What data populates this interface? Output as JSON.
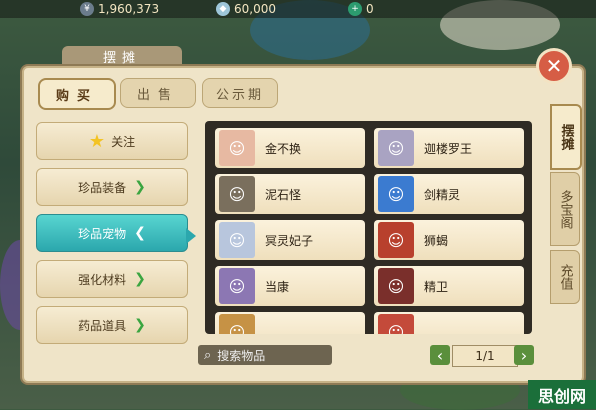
{
  "resources": {
    "coins": "1,960,373",
    "silver": "60,000",
    "jade": "0"
  },
  "panel": {
    "title": "摆摊",
    "close_icon": "close-icon"
  },
  "tabs": [
    {
      "label": "购买",
      "active": true
    },
    {
      "label": "出售",
      "active": false
    },
    {
      "label": "公示期",
      "active": false
    }
  ],
  "categories": [
    {
      "label": "关注",
      "icon": "star-icon"
    },
    {
      "label": "珍品装备",
      "icon": "arrow-right-icon"
    },
    {
      "label": "珍品宠物",
      "icon": "arrow-left-icon",
      "active": true
    },
    {
      "label": "强化材料",
      "icon": "arrow-right-icon"
    },
    {
      "label": "药品道具",
      "icon": "arrow-right-icon"
    }
  ],
  "items": [
    {
      "name": "金不换",
      "color": "#e7b9a2"
    },
    {
      "name": "迦楼罗王",
      "color": "#a9a3c2"
    },
    {
      "name": "泥石怪",
      "color": "#7a6f5d"
    },
    {
      "name": "剑精灵",
      "color": "#3b7bd0"
    },
    {
      "name": "冥灵妃子",
      "color": "#b8c6dd"
    },
    {
      "name": "狮蝎",
      "color": "#b8402d"
    },
    {
      "name": "当康",
      "color": "#8c77b3"
    },
    {
      "name": "精卫",
      "color": "#7a2f2b"
    },
    {
      "name": "",
      "color": "#c69245"
    },
    {
      "name": "",
      "color": "#c44a3a"
    }
  ],
  "search": {
    "placeholder": "搜索物品"
  },
  "pager": {
    "text": "1/1",
    "prev": "‹",
    "next": "›"
  },
  "side_tabs": [
    {
      "label": "摆摊",
      "active": true
    },
    {
      "label": "多宝阁",
      "active": false
    },
    {
      "label": "充值",
      "active": false
    }
  ],
  "watermark": "思创网",
  "colors": {
    "accent_teal": "#2ba7ad",
    "arrow_green": "#3aa540",
    "close_red": "#d65d45"
  }
}
